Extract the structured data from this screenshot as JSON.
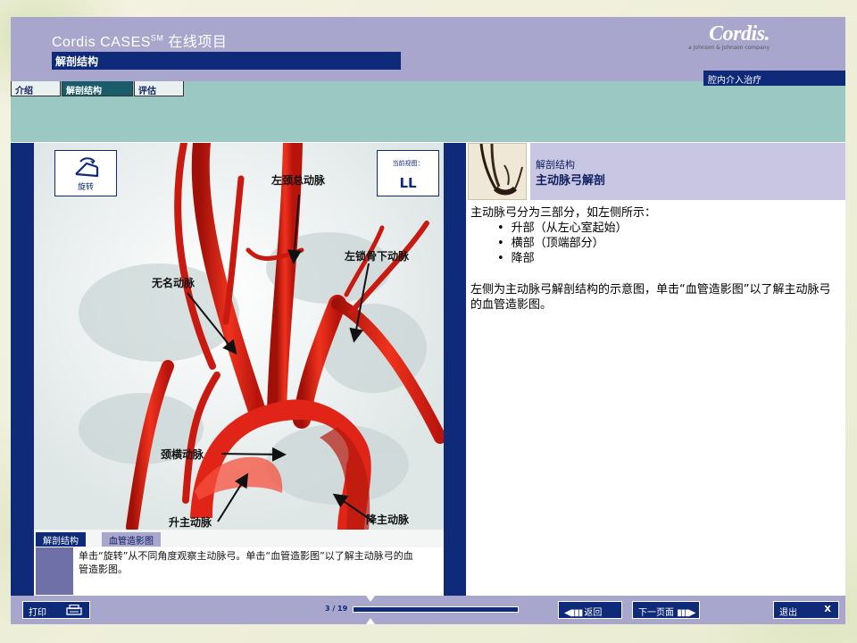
{
  "header": {
    "app_title_prefix": "Cordis CASES",
    "app_title_sup": "SM",
    "app_title_suffix": " 在线项目",
    "section": "解剖结构",
    "brand_logo": "Cordis.",
    "brand_sub": "a Johnson & Johnson company",
    "tagline": "腔内介入治疗"
  },
  "tabs": [
    {
      "label": "介绍",
      "active": false
    },
    {
      "label": "解剖结构",
      "active": true
    },
    {
      "label": "评估",
      "active": false
    }
  ],
  "viewer": {
    "rotate_label": "旋转",
    "current_view_caption": "当前视图：",
    "current_view_value": "LL",
    "annotations": {
      "left_common_carotid": "左颈总动脉",
      "left_subclavian": "左锁骨下动脉",
      "innominate": "无名动脉",
      "transverse_arch": "颈横动脉",
      "ascending_aorta": "升主动脉",
      "descending_aorta": "降主动脉"
    },
    "subtabs": [
      {
        "label": "解剖结构",
        "active": true
      },
      {
        "label": "血管造影图",
        "active": false
      }
    ],
    "caption": "单击“旋转”从不同角度观察主动脉弓。单击“血管造影图”以了解主动脉弓的血管造影图。"
  },
  "topic": {
    "small": "解剖结构",
    "big": "主动脉弓解剖"
  },
  "content": {
    "intro": "主动脉弓分为三部分，如左侧所示：",
    "bullets": [
      "升部（从左心室起始）",
      "横部（顶端部分）",
      "降部"
    ],
    "paragraph": "左侧为主动脉弓解剖结构的示意图，单击“血管造影图”以了解主动脉弓的血管造影图。"
  },
  "nav": {
    "print": "打印",
    "page_indicator": "3 / 19",
    "progress_fraction": 0.11,
    "back": "返回",
    "next": "下一页面",
    "exit": "退出",
    "exit_x": "X"
  },
  "colors": {
    "navy": "#0e2a78",
    "lavender": "#a8a6cc",
    "teal": "#9cc8c4",
    "artery_red": "#e0221a"
  }
}
